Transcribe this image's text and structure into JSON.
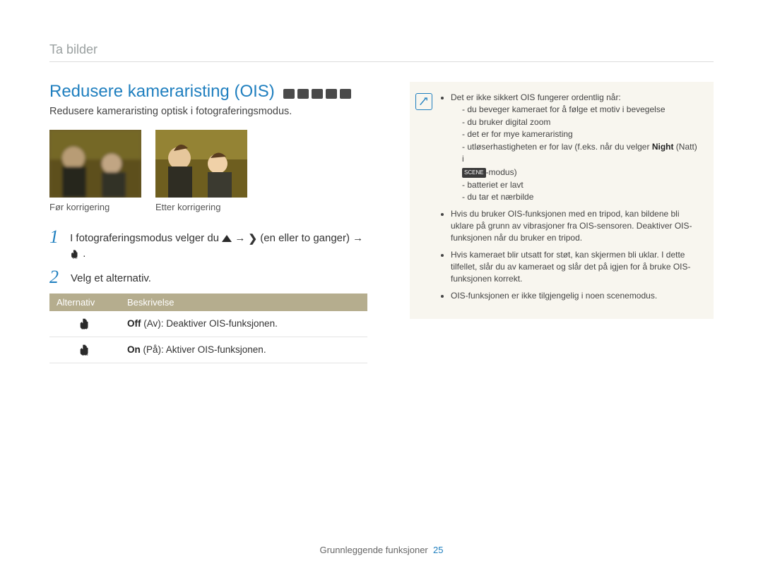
{
  "breadcrumb": "Ta bilder",
  "heading": "Redusere kameraristing (OIS)",
  "subtitle": "Redusere kameraristing optisk i fotograferingsmodus.",
  "photos": {
    "before_caption": "Før korrigering",
    "after_caption": "Etter korrigering"
  },
  "steps": {
    "s1_a": "I fotograferingsmodus velger du ",
    "s1_b": " → ",
    "s1_c": " (en eller to ganger) → ",
    "s1_d": " .",
    "s2": "Velg et alternativ."
  },
  "table": {
    "col_alt": "Alternativ",
    "col_desc": "Beskrivelse",
    "off_label": "Off",
    "off_sub": " (Av): Deaktiver OIS-funksjonen.",
    "on_label": "On",
    "on_sub": " (På): Aktiver OIS-funksjonen."
  },
  "notes": {
    "intro": "Det er ikke sikkert OIS fungerer ordentlig når:",
    "a": "du beveger kameraet for å følge et motiv i bevegelse",
    "b": "du bruker digital zoom",
    "c": "det er for mye kameraristing",
    "d_a": "utløserhastigheten er for lav (f.eks. når du velger ",
    "d_bold": "Night",
    "d_b": " (Natt) i",
    "d_chip": "SCENE",
    "d_c": "-modus)",
    "e": "batteriet er lavt",
    "f": "du tar et nærbilde",
    "n2": "Hvis du bruker OIS-funksjonen med en tripod, kan bildene bli uklare på grunn av vibrasjoner fra OIS-sensoren. Deaktiver OIS-funksjonen når du bruker en tripod.",
    "n3": "Hvis kameraet blir utsatt for støt, kan skjermen bli uklar. I dette tilfellet, slår du av kameraet og slår det på igjen for å bruke OIS-funksjonen korrekt.",
    "n4": "OIS-funksjonen er ikke tilgjengelig i noen scenemodus."
  },
  "footer": {
    "section": "Grunnleggende funksjoner",
    "page": "25"
  }
}
